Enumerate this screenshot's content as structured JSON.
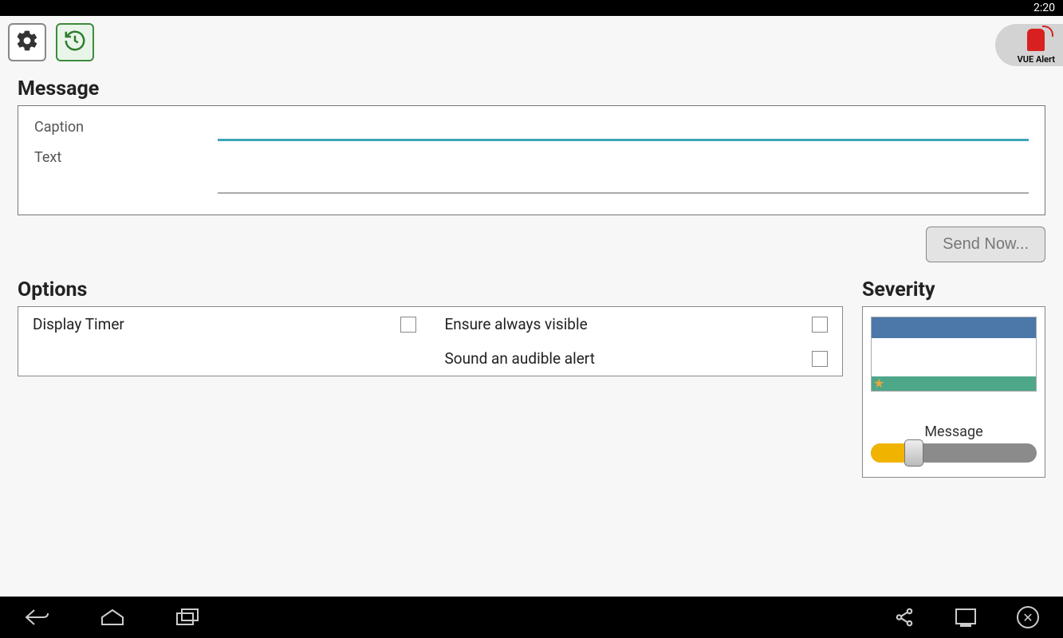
{
  "status": {
    "time": "2:20"
  },
  "logo": {
    "label": "VUE Alert"
  },
  "sections": {
    "message": "Message",
    "options": "Options",
    "severity": "Severity"
  },
  "message": {
    "captionLabel": "Caption",
    "captionValue": "",
    "textLabel": "Text",
    "textValue": ""
  },
  "buttons": {
    "send": "Send Now..."
  },
  "options": {
    "displayTimer": "Display Timer",
    "ensureVisible": "Ensure always visible",
    "soundAlert": "Sound an audible alert"
  },
  "severity": {
    "sliderLabel": "Message"
  }
}
